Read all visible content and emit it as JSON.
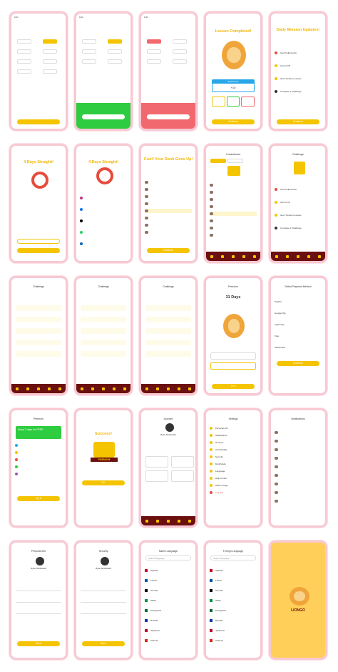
{
  "screens": {
    "lesson_completed": {
      "title": "Lesson Completed!",
      "experience_label": "Experience",
      "xp_value": "+10",
      "continue_label": "Continue"
    },
    "daily_mission": {
      "title": "Daily Mission Updates!",
      "items": [
        "Get 30 diamonds",
        "Get 10 XP",
        "Get 3 Perfect Lessons",
        "Complete 1 Challenge"
      ],
      "continue_label": "Continue"
    },
    "streak": {
      "title": "4 Days Straight!"
    },
    "rank": {
      "title": "Cool! Your Rank Goes Up!",
      "continue_label": "Continue"
    },
    "leaderboard": {
      "title": "Leaderboard"
    },
    "challenge": {
      "title": "Challenge"
    },
    "premium_days": {
      "title": "Premium",
      "days": "31 Days",
      "try_label": "Try it"
    },
    "payment": {
      "title": "Select Payment Method",
      "methods": [
        "PayPal",
        "Google Pay",
        "Apple Pay",
        "Visa",
        "Mastercard"
      ],
      "continue_label": "Continue"
    },
    "premium": {
      "title": "Premium",
      "banner": "Enjoy 7 days for FREE",
      "try_label": "Try It"
    },
    "success": {
      "title": "Success!",
      "badge": "PREMIUM",
      "ok_label": "OK"
    },
    "account": {
      "title": "Account",
      "name": "Ryan Rodriwack"
    },
    "settings": {
      "title": "Settings",
      "items": [
        "Personal Info",
        "Notifications",
        "General",
        "Accessibility",
        "Security",
        "Dark Mode",
        "Language",
        "Help Center",
        "About Liongo",
        "Log Out"
      ]
    },
    "notifications": {
      "title": "Notifications"
    },
    "personal_info": {
      "title": "Personal Info",
      "name": "Ryan Rodriwack",
      "save_label": "Save"
    },
    "security": {
      "title": "Security",
      "name": "Ryan Rodriwack",
      "save_label": "Save"
    },
    "native_language": {
      "title": "Native Language",
      "search": "Search language",
      "langs": [
        "Spanish",
        "French",
        "German",
        "Italian",
        "Portuguese",
        "Russian",
        "Japanese",
        "Chinese"
      ]
    },
    "foreign_language": {
      "title": "Foreign Language",
      "search": "Search language",
      "langs": [
        "Spanish",
        "French",
        "German",
        "Italian",
        "Portuguese",
        "Russian",
        "Japanese",
        "Chinese"
      ]
    },
    "splash": {
      "brand": "LIONGO"
    }
  },
  "colors": {
    "accent": "#f5c400",
    "dark": "#6b0f0f",
    "correct": "#2ecc40",
    "wrong": "#f2686f"
  }
}
